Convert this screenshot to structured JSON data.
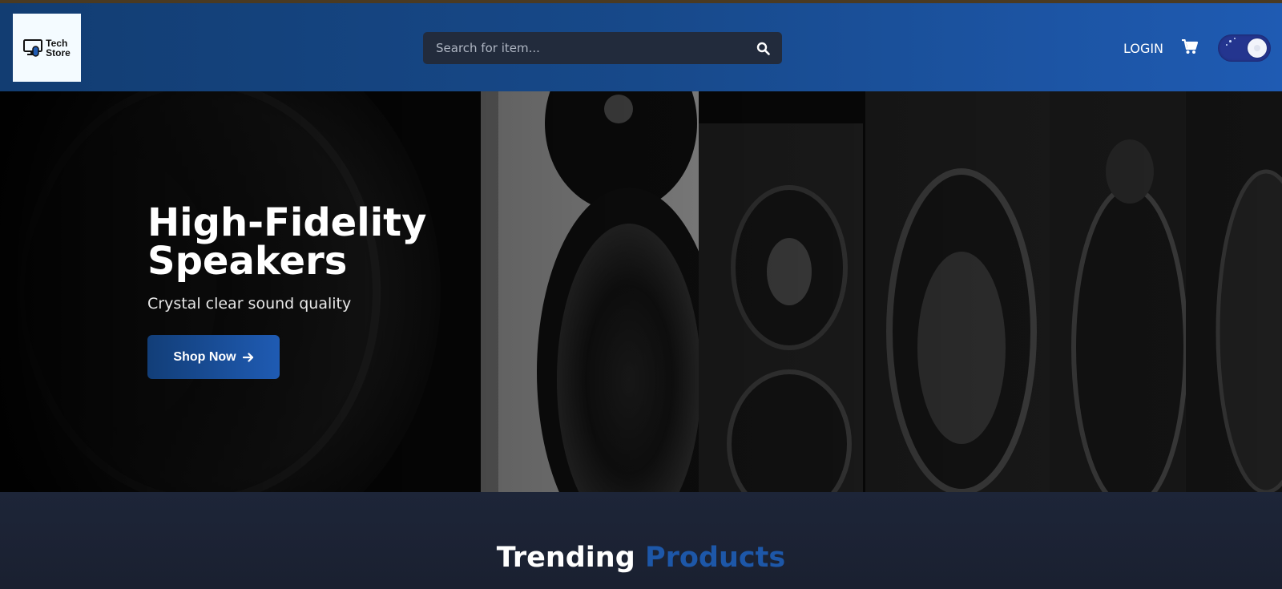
{
  "header": {
    "logo_text_line1": "Tech",
    "logo_text_line2": "Store",
    "search_placeholder": "Search for item...",
    "login_label": "LOGIN",
    "cart_icon": "cart-icon",
    "theme_toggle": "dark-mode-toggle"
  },
  "hero": {
    "title_line1": "High-Fidelity",
    "title_line2": "Speakers",
    "subtitle": "Crystal clear sound quality",
    "cta_label": "Shop Now",
    "cta_icon": "arrow-right-icon"
  },
  "trending": {
    "title_part1": "Trending",
    "title_part2": "Products"
  },
  "colors": {
    "header_start": "#123d72",
    "header_end": "#1f5bb3",
    "accent": "#1d57a8",
    "page_bg": "#1b2233"
  }
}
